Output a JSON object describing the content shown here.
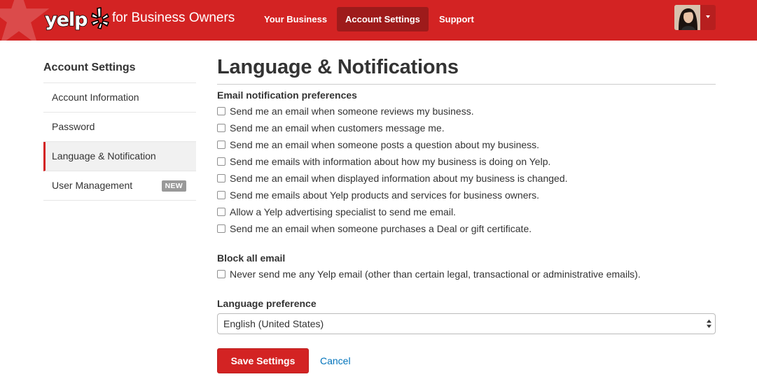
{
  "header": {
    "logo_text": "yelp",
    "for_business": "for Business Owners",
    "nav": [
      {
        "label": "Your Business",
        "active": false
      },
      {
        "label": "Account Settings",
        "active": true
      },
      {
        "label": "Support",
        "active": false
      }
    ],
    "brand_color": "#d32323"
  },
  "sidebar": {
    "title": "Account Settings",
    "items": [
      {
        "label": "Account Information",
        "active": false
      },
      {
        "label": "Password",
        "active": false
      },
      {
        "label": "Language & Notification",
        "active": true
      },
      {
        "label": "User Management",
        "active": false,
        "badge": "NEW"
      }
    ]
  },
  "main": {
    "title": "Language & Notifications",
    "email_section": {
      "label": "Email notification preferences",
      "options": [
        {
          "label": "Send me an email when someone reviews my business.",
          "checked": false
        },
        {
          "label": "Send me an email when customers message me.",
          "checked": false
        },
        {
          "label": "Send me an email when someone posts a question about my business.",
          "checked": false
        },
        {
          "label": "Send me emails with information about how my business is doing on Yelp.",
          "checked": false
        },
        {
          "label": "Send me an email when displayed information about my business is changed.",
          "checked": false
        },
        {
          "label": "Send me emails about Yelp products and services for business owners.",
          "checked": false
        },
        {
          "label": "Allow a Yelp advertising specialist to send me email.",
          "checked": false
        },
        {
          "label": "Send me an email when someone purchases a Deal or gift certificate.",
          "checked": false
        }
      ]
    },
    "block_section": {
      "label": "Block all email",
      "option": {
        "label": "Never send me any Yelp email (other than certain legal, transactional or administrative emails).",
        "checked": false
      }
    },
    "language_section": {
      "label": "Language preference",
      "selected": "English (United States)"
    },
    "save_label": "Save Settings",
    "cancel_label": "Cancel"
  }
}
